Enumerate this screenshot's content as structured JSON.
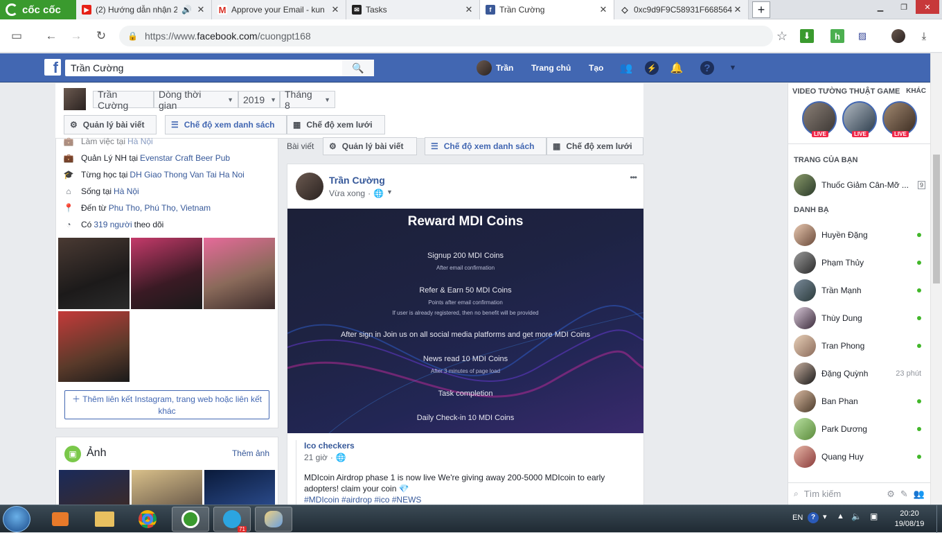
{
  "browser": {
    "brand": "cốc cốc",
    "tabs": [
      {
        "title": "(2) Hướng dẫn nhận 2",
        "fav": "youtube-icon"
      },
      {
        "title": "Approve your Email - kun",
        "fav": "gmail-icon"
      },
      {
        "title": "Tasks",
        "fav": "tasks-icon"
      },
      {
        "title": "Trần Cường",
        "fav": "facebook-icon"
      },
      {
        "title": "0xc9d9F9C58931F668564",
        "fav": "ethereum-icon"
      }
    ],
    "url_prefix": "https://www.",
    "url_domain": "facebook.com",
    "url_path": "/cuongpt168"
  },
  "fb_header": {
    "search_value": "Trần Cường",
    "profile_name": "Trần",
    "home": "Trang chủ",
    "create": "Tạo"
  },
  "timeline_bar": {
    "name": "Trần Cường",
    "timeline": "Dòng thời gian",
    "year": "2019",
    "month": "Tháng 8",
    "manage": "Quản lý bài viết",
    "list_view": "Chế độ xem danh sách",
    "grid_view": "Chế độ xem lưới"
  },
  "intro": {
    "row0": {
      "pre": "Làm việc tại",
      "link": "Hà Nội"
    },
    "row1": {
      "pre": "Quản Lý NH tại",
      "link": "Evenstar Craft Beer Pub"
    },
    "row2": {
      "pre": "Từng học tại",
      "link": "DH Giao Thong Van Tai Ha Noi"
    },
    "row3": {
      "pre": "Sống tại",
      "link": "Hà Nội"
    },
    "row4": {
      "pre": "Đến từ",
      "link": "Phu Tho, Phú Thọ, Vietnam"
    },
    "row5": {
      "pre": "Có",
      "link": "319 người",
      "post": "theo dõi"
    },
    "add_link": "Thêm liên kết Instagram, trang web hoặc liên kết khác"
  },
  "photos": {
    "title": "Ảnh",
    "more": "Thêm ảnh"
  },
  "center_bar": {
    "posts": "Bài viết",
    "manage": "Quản lý bài viết",
    "list_view": "Chế độ xem danh sách",
    "grid_view": "Chế độ xem lưới"
  },
  "post": {
    "author": "Trần Cường",
    "time": "Vừa xong",
    "more": "•••",
    "banner": {
      "title": "Reward MDI Coins",
      "l1": "Signup 200 MDI Coins",
      "l1s": "After email confirmation",
      "l2": "Refer & Earn 50 MDI Coins",
      "l2s": "Points after email confirmation",
      "l2s2": "If user is already registered, then no benefit will be provided",
      "l3": "After sign in Join us on all social media platforms and get more MDI Coins",
      "l4": "News read 10 MDI Coins",
      "l4s": "After 3 minutes of page load",
      "l5": "Task completion",
      "l6": "Daily Check-in 10 MDI Coins"
    },
    "shared_author": "Ico checkers",
    "shared_time": "21 giờ",
    "body": "MDIcoin Airdrop phase 1 is now live We're giving away 200-5000 MDIcoin to early adopters! claim your coin 💎",
    "tags": "#MDIcoin #airdrop #ico #NEWS"
  },
  "sidebar": {
    "live_title": "VIDEO TƯỜNG THUẬT GAME",
    "live_more": "KHÁC",
    "live_badge": "LIVE",
    "pages_title": "TRANG CỦA BẠN",
    "page_name": "Thuốc Giảm Cân-Mỡ ...",
    "page_count": "9",
    "contacts_title": "DANH BẠ",
    "contacts": [
      {
        "name": "Huyền Đặng",
        "status": "online"
      },
      {
        "name": "Phạm Thủy",
        "status": "online"
      },
      {
        "name": "Trần Mạnh",
        "status": "online"
      },
      {
        "name": "Thùy Dung",
        "status": "online"
      },
      {
        "name": "Tran Phong",
        "status": "online"
      },
      {
        "name": "Đặng Quỳnh",
        "status": "23 phút"
      },
      {
        "name": "Ban Phan",
        "status": "online"
      },
      {
        "name": "Park Dương",
        "status": "online"
      },
      {
        "name": "Quang Huy",
        "status": "online"
      }
    ],
    "search_placeholder": "Tìm kiếm"
  },
  "taskbar": {
    "lang": "EN",
    "time": "20:20",
    "date": "19/08/19",
    "telegram_badge": "71"
  }
}
